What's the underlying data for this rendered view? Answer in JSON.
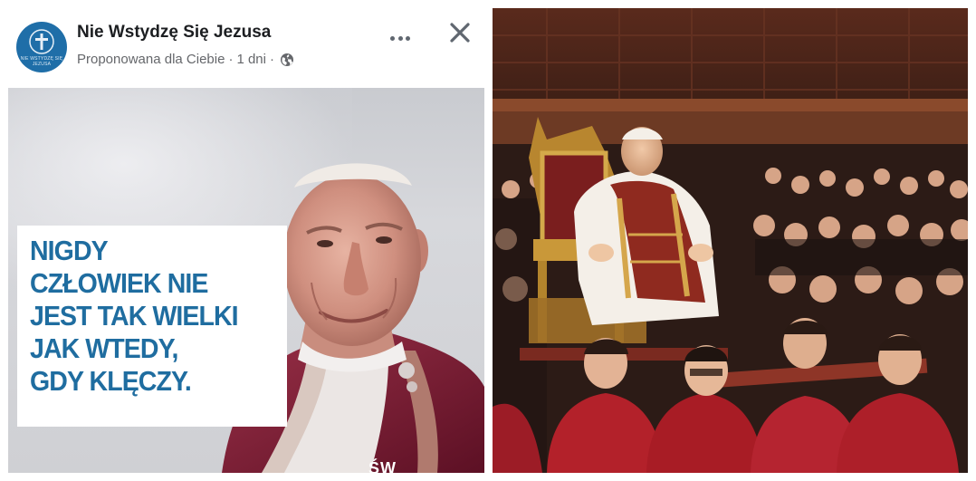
{
  "post": {
    "page_name": "Nie Wstydzę Się Jezusa",
    "avatar_text": "NIE WSTYDZĘ SIĘ JEZUSA",
    "suggested_label": "Proponowana dla Ciebie",
    "separator": "·",
    "time_ago": "1 dni",
    "audience_icon": "globe-icon",
    "more_icon": "more-options-icon",
    "close_icon": "close-icon",
    "image": {
      "quote_lines": [
        "NIGDY",
        "CZŁOWIEK NIE",
        "JEST TAK WIELKI",
        "JAK WTEDY,",
        "GDY KLĘCZY."
      ],
      "watermark": "ŚW",
      "colors": {
        "quote_text": "#1f6da0",
        "background": "#cfd0d4",
        "mozzetta": "#8a2237"
      }
    }
  },
  "photo": {
    "subject": "pope-on-sedia-gestatoria-photo",
    "colors": {
      "attendants_red": "#b3212a",
      "backdrop": "#4a2418"
    }
  }
}
